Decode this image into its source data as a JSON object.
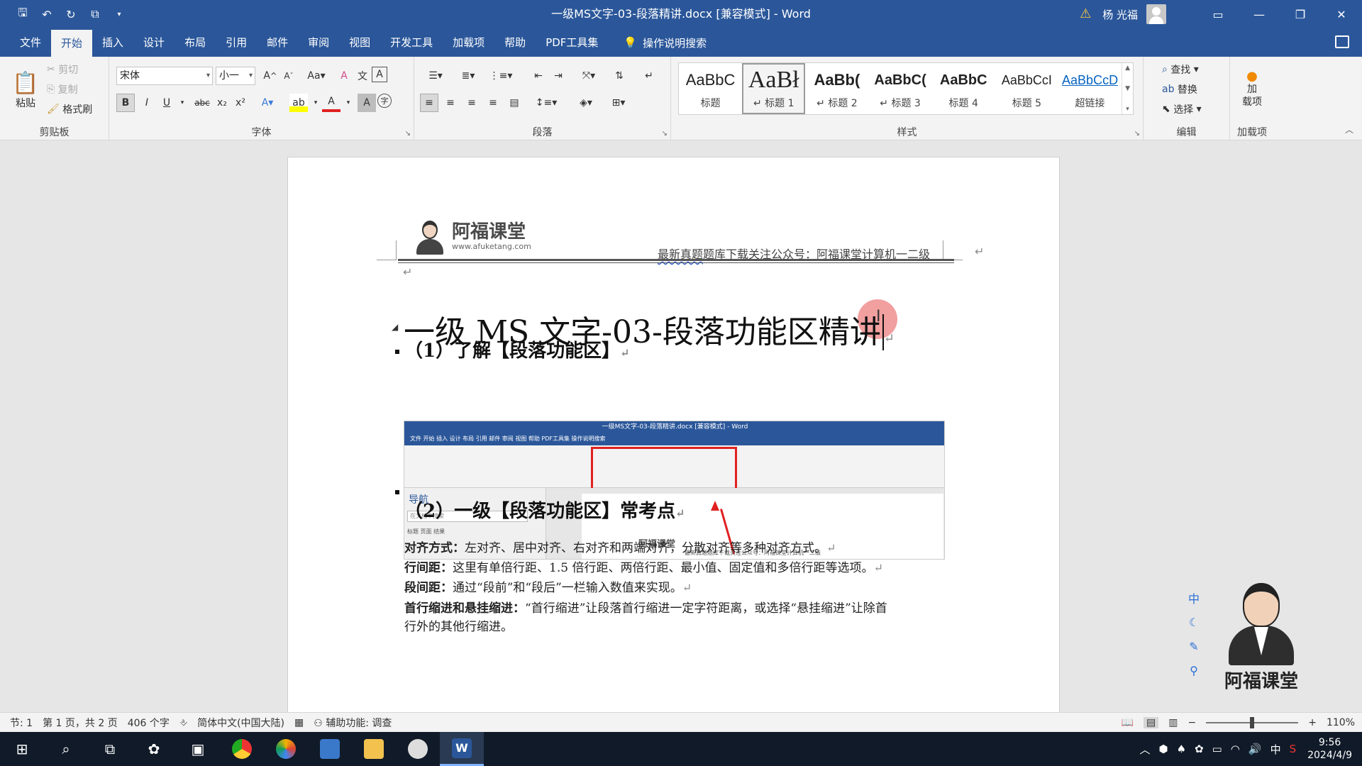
{
  "window": {
    "title": "一级MS文字-03-段落精讲.docx [兼容模式]  -  Word",
    "user_name": "杨 光福",
    "qat_icons": [
      "save-icon",
      "undo-icon",
      "redo-icon",
      "touch-mode-icon",
      "customize-icon"
    ]
  },
  "tabs": [
    "文件",
    "开始",
    "插入",
    "设计",
    "布局",
    "引用",
    "邮件",
    "审阅",
    "视图",
    "开发工具",
    "加载项",
    "帮助",
    "PDF工具集"
  ],
  "active_tab": "开始",
  "tell_me": "操作说明搜索",
  "ribbon": {
    "clipboard": {
      "paste": "粘贴",
      "cut": "剪切",
      "copy": "复制",
      "format_painter": "格式刷",
      "label": "剪贴板"
    },
    "font": {
      "family": "宋体",
      "size": "小一",
      "label": "字体",
      "change_case": "Aa",
      "bold": "B",
      "italic": "I",
      "underline": "U",
      "strike": "abc",
      "sub": "x₂",
      "sup": "x²",
      "clear_format": "A",
      "pinyin": "文",
      "border": "A",
      "grow": "A",
      "shrink": "A",
      "color": "A",
      "highlight": "ab",
      "shading": "A",
      "circle": "字"
    },
    "paragraph": {
      "label": "段落"
    },
    "styles": {
      "label": "样式",
      "items": [
        {
          "preview": "AaBbC",
          "name": "标题"
        },
        {
          "preview": "AaBł",
          "name": "↵ 标题 1"
        },
        {
          "preview": "AaBb(",
          "name": "↵ 标题 2"
        },
        {
          "preview": "AaBbC(",
          "name": "↵ 标题 3"
        },
        {
          "preview": "AaBbC",
          "name": "标题 4"
        },
        {
          "preview": "AaBbCcI",
          "name": "标题 5"
        },
        {
          "preview": "AaBbCcD",
          "name": "超链接"
        }
      ]
    },
    "editing": {
      "find": "查找",
      "replace": "替换",
      "select": "选择",
      "label": "编辑"
    },
    "addins": {
      "button": "加\n载项",
      "label": "加载项"
    }
  },
  "document": {
    "header_brand": "阿福课堂",
    "header_url": "www.afuketang.com",
    "header_text_wavy": "最新真题",
    "header_text_rest": "题库下载关注公众号：阿福课堂计算机一二级",
    "title": "一级 MS 文字-03-段落功能区精讲",
    "h2_1": "（1）了解【段落功能区】",
    "h2_2": "（2）一级【段落功能区】常考点",
    "lines": [
      {
        "label": "对齐方式：",
        "text": "左对齐、居中对齐、右对齐和两端对齐，分散对齐等多种对齐方式。"
      },
      {
        "label": "行间距：",
        "text": "这里有单倍行距、1.5 倍行距、两倍行距、最小值、固定值和多倍行距等选项。"
      },
      {
        "label": "段间距：",
        "text": "通过“段前”和“段后”一栏输入数值来实现。"
      },
      {
        "label": "首行缩进和悬挂缩进：",
        "text": "“首行缩进”让段落首行缩进一定字符距离，或选择“悬挂缩进”让除首"
      },
      {
        "label": "",
        "text": "行外的其他行缩进。"
      }
    ],
    "embedded_screenshot": {
      "title": "一级MS文字-03-段落精讲.docx [兼容模式] - Word",
      "tabs": "文件   开始   插入   设计   布局   引用   邮件   审阅   视图   帮助   PDF工具集   操作说明搜索",
      "nav_title": "导航",
      "nav_search": "在文档中搜索",
      "nav_tabs": "标题    页面    结果",
      "brand": "阿福课堂",
      "header_text": "最新真题题库下载关注公众号：阿福课堂计算机一二级"
    }
  },
  "statusbar": {
    "section": "节: 1",
    "page": "第 1 页，共 2 页",
    "words": "406 个字",
    "language": "简体中文(中国大陆)",
    "accessibility": "辅助功能: 调查",
    "zoom": "110%",
    "zoom_minus": "−",
    "zoom_plus": "+"
  },
  "side_tools": [
    "中",
    "☾",
    "✎",
    "⚲"
  ],
  "mascot_name": "阿福课堂",
  "taskbar": {
    "time": "9:56",
    "date": "2024/4/9",
    "ime": "中"
  }
}
